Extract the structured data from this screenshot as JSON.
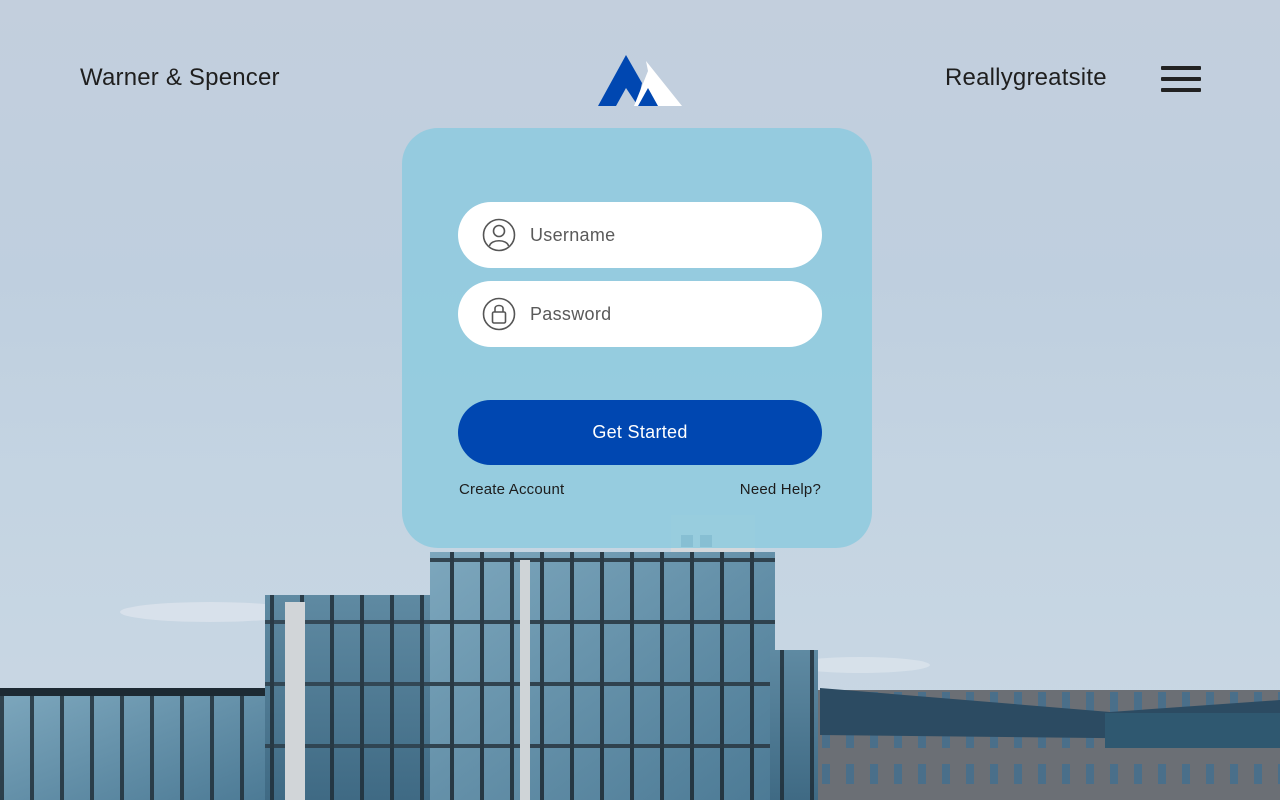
{
  "header": {
    "brand": "Warner & Spencer",
    "site": "Reallygreatsite",
    "menu_icon": "hamburger-menu-icon",
    "logo_icon": "mountain-peaks-logo"
  },
  "form": {
    "username": {
      "placeholder": "Username",
      "value": "",
      "icon": "user-icon"
    },
    "password": {
      "placeholder": "Password",
      "value": "",
      "icon": "lock-icon"
    },
    "submit_label": "Get Started",
    "create_account": "Create Account",
    "need_help": "Need Help?"
  },
  "colors": {
    "accent": "#0047b1",
    "card": "#8ecbde",
    "logo_secondary": "#ffffff"
  }
}
